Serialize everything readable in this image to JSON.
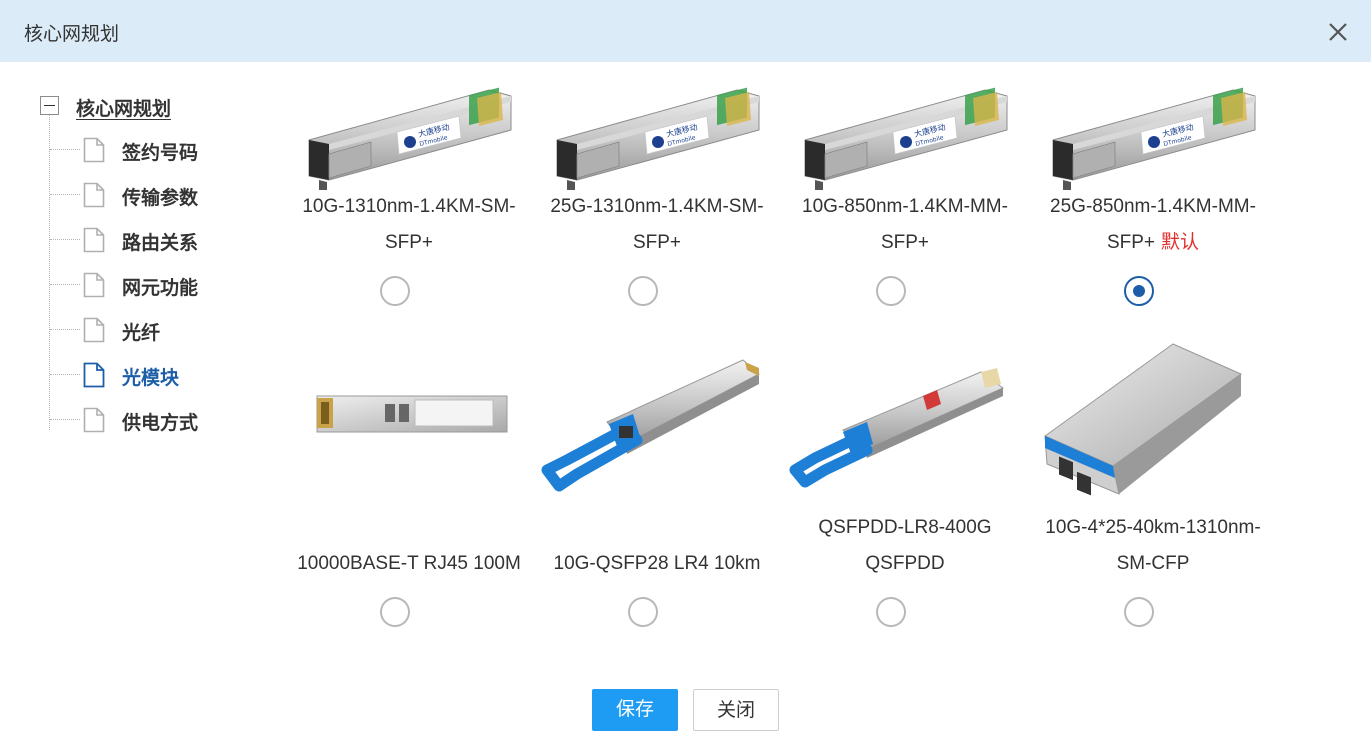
{
  "dialog": {
    "title": "核心网规划",
    "close_icon": "close-icon"
  },
  "tree": {
    "root_label": "核心网规划",
    "items": [
      {
        "label": "签约号码",
        "active": false
      },
      {
        "label": "传输参数",
        "active": false
      },
      {
        "label": "路由关系",
        "active": false
      },
      {
        "label": "网元功能",
        "active": false
      },
      {
        "label": "光纤",
        "active": false
      },
      {
        "label": "光模块",
        "active": true
      },
      {
        "label": "供电方式",
        "active": false
      }
    ]
  },
  "modules": [
    {
      "line1": "10G-1310nm-1.4KM-SM-",
      "line2": "SFP+",
      "badge": "",
      "selected": false,
      "image": "sfp-module-image"
    },
    {
      "line1": "25G-1310nm-1.4KM-SM-",
      "line2": "SFP+",
      "badge": "",
      "selected": false,
      "image": "sfp-module-image"
    },
    {
      "line1": "10G-850nm-1.4KM-MM-",
      "line2": "SFP+",
      "badge": "",
      "selected": false,
      "image": "sfp-module-image"
    },
    {
      "line1": "25G-850nm-1.4KM-MM-",
      "line2": "SFP+",
      "badge": "默认",
      "selected": true,
      "image": "sfp-module-image"
    },
    {
      "line1": "",
      "line2": "10000BASE-T RJ45 100M",
      "badge": "",
      "selected": false,
      "image": "rj45-module-image"
    },
    {
      "line1": "",
      "line2": "10G-QSFP28 LR4 10km",
      "badge": "",
      "selected": false,
      "image": "qsfp28-module-image"
    },
    {
      "line1": "QSFPDD-LR8-400G",
      "line2": "QSFPDD",
      "badge": "",
      "selected": false,
      "image": "qsfpdd-module-image"
    },
    {
      "line1": "10G-4*25-40km-1310nm-",
      "line2": "SM-CFP",
      "badge": "",
      "selected": false,
      "image": "cfp-module-image"
    }
  ],
  "sfp_label": {
    "brand_cn": "大唐移动",
    "brand_en": "DTmobile"
  },
  "colors": {
    "accent": "#1c5fa8",
    "primary_button": "#1e9bf3",
    "header_bg": "#dcebf8",
    "default_badge": "#e0302b"
  },
  "buttons": {
    "save": "保存",
    "close": "关闭"
  }
}
